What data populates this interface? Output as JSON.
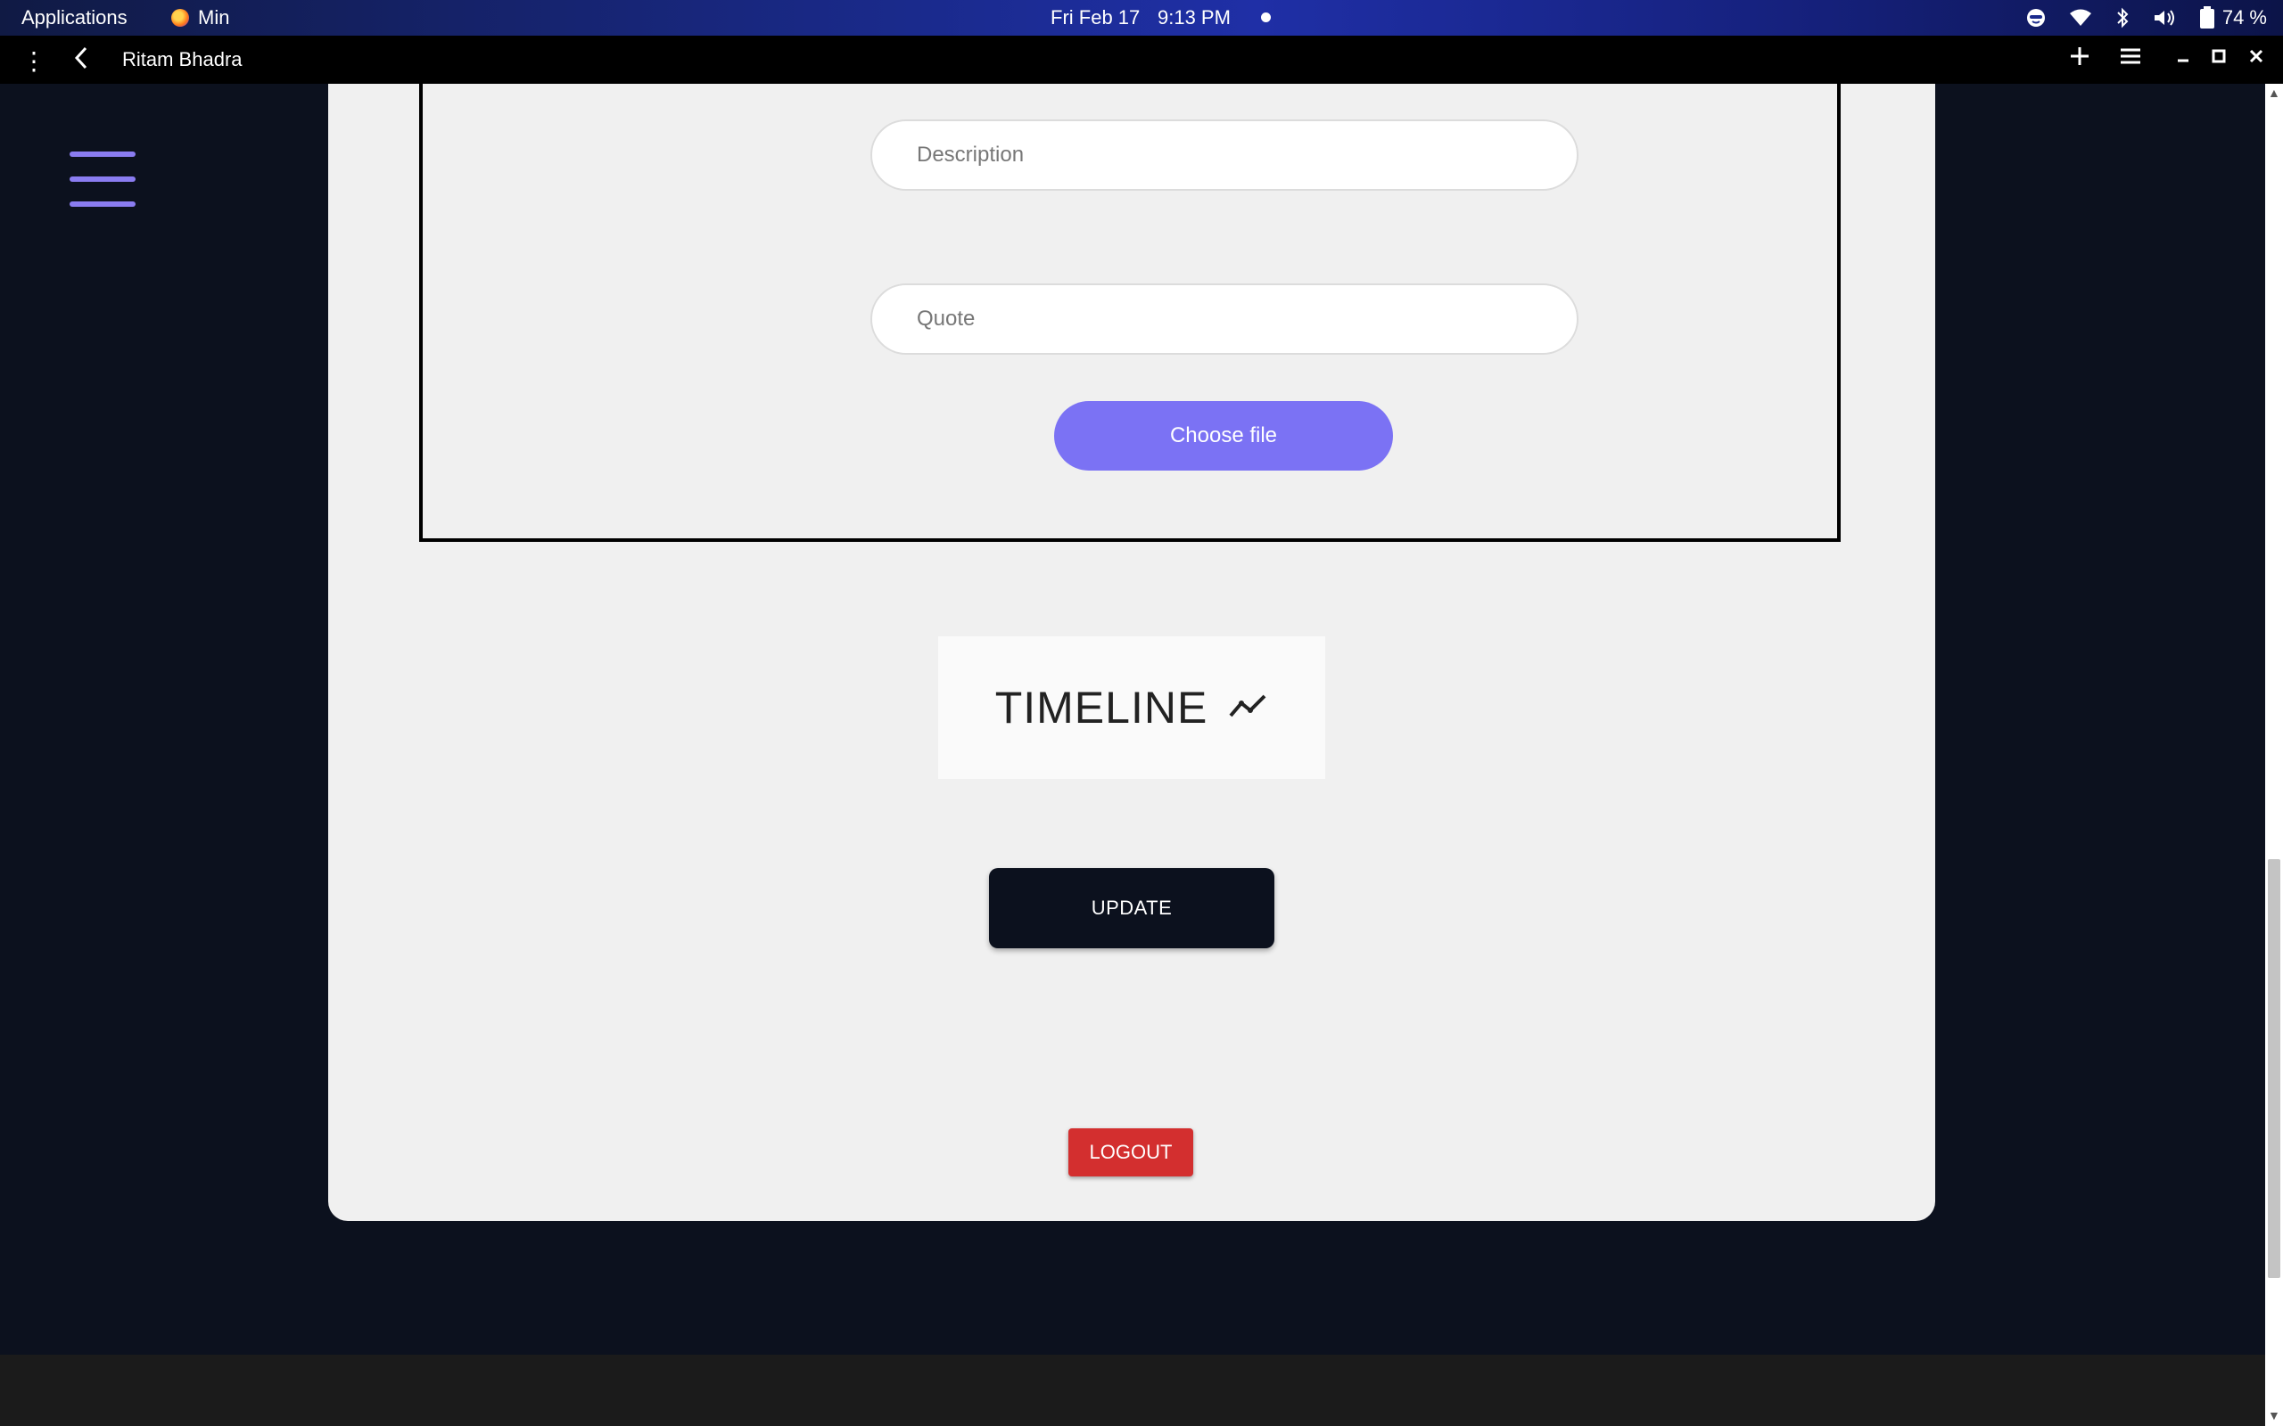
{
  "system_bar": {
    "applications": "Applications",
    "active_app": "Min",
    "date": "Fri Feb 17",
    "time": "9:13 PM",
    "battery": "74 %"
  },
  "browser": {
    "tab_title": "Ritam Bhadra"
  },
  "form": {
    "description_placeholder": "Description",
    "quote_placeholder": "Quote",
    "choose_file_label": "Choose file"
  },
  "timeline": {
    "label": "TIMELINE"
  },
  "actions": {
    "update_label": "UPDATE",
    "logout_label": "LOGOUT"
  },
  "colors": {
    "accent": "#7b72f4",
    "background": "#0c111e",
    "logout": "#d32f2f"
  }
}
